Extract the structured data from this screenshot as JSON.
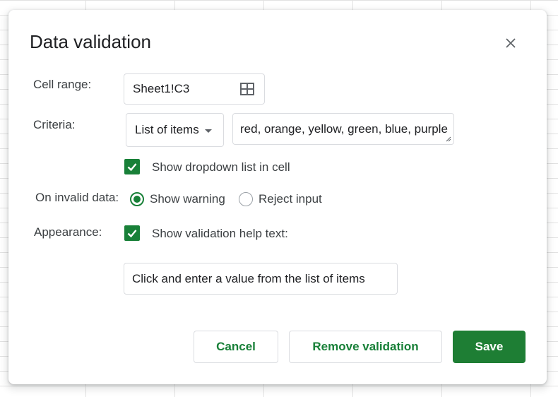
{
  "dialog": {
    "title": "Data validation",
    "close_icon": "close-icon"
  },
  "cell_range": {
    "label": "Cell range:",
    "value": "Sheet1!C3",
    "icon": "grid-select-icon"
  },
  "criteria": {
    "label": "Criteria:",
    "type": "List of items",
    "items": "red, orange, yellow, green, blue, purple"
  },
  "dropdown": {
    "label": "Show dropdown list in cell",
    "checked": true
  },
  "invalid": {
    "label": "On invalid data:",
    "options": [
      {
        "label": "Show warning",
        "selected": true
      },
      {
        "label": "Reject input",
        "selected": false
      }
    ]
  },
  "appearance": {
    "label": "Appearance:",
    "help_label": "Show validation help text:",
    "help_checked": true,
    "help_text": "Click and enter a value from the list of items"
  },
  "buttons": {
    "cancel": "Cancel",
    "remove": "Remove validation",
    "save": "Save"
  },
  "colors": {
    "accent": "#188038",
    "save_bg": "#1e7e34"
  }
}
